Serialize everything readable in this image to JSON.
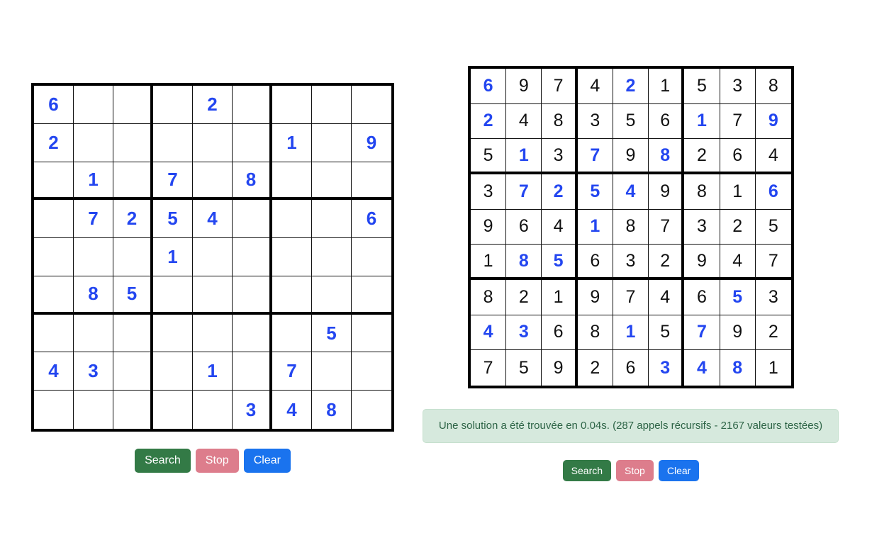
{
  "app": {
    "language": "fr",
    "accent_blue": "#2346f0",
    "button_colors": {
      "search": "#337a46",
      "stop": "#dd7d8c",
      "clear": "#1a73ee"
    },
    "status_colors": {
      "background": "#d6e9dd",
      "text": "#2d6446"
    }
  },
  "controls": {
    "search_label": "Search",
    "stop_label": "Stop",
    "clear_label": "Clear"
  },
  "puzzle_panel": {
    "title": "",
    "grid": {
      "size": 9,
      "rows": [
        [
          "6",
          "",
          "",
          "",
          "2",
          "",
          "",
          "",
          ""
        ],
        [
          "2",
          "",
          "",
          "",
          "",
          "",
          "1",
          "",
          "9"
        ],
        [
          "",
          "1",
          "",
          "7",
          "",
          "8",
          "",
          "",
          ""
        ],
        [
          "",
          "7",
          "2",
          "5",
          "4",
          "",
          "",
          "",
          "6"
        ],
        [
          "",
          "",
          "",
          "1",
          "",
          "",
          "",
          "",
          ""
        ],
        [
          "",
          "8",
          "5",
          "",
          "",
          "",
          "",
          "",
          ""
        ],
        [
          "",
          "",
          "",
          "",
          "",
          "",
          "",
          "5",
          ""
        ],
        [
          "4",
          "3",
          "",
          "",
          "1",
          "",
          "7",
          "",
          ""
        ],
        [
          "",
          "",
          "",
          "",
          "",
          "3",
          "4",
          "8",
          ""
        ]
      ],
      "given_flags": [
        [
          1,
          0,
          0,
          0,
          1,
          0,
          0,
          0,
          0
        ],
        [
          1,
          0,
          0,
          0,
          0,
          0,
          1,
          0,
          1
        ],
        [
          0,
          1,
          0,
          1,
          0,
          1,
          0,
          0,
          0
        ],
        [
          0,
          1,
          1,
          1,
          1,
          0,
          0,
          0,
          1
        ],
        [
          0,
          0,
          0,
          1,
          0,
          0,
          0,
          0,
          0
        ],
        [
          0,
          1,
          1,
          0,
          0,
          0,
          0,
          0,
          0
        ],
        [
          0,
          0,
          0,
          0,
          0,
          0,
          0,
          1,
          0
        ],
        [
          1,
          1,
          0,
          0,
          1,
          0,
          1,
          0,
          0
        ],
        [
          0,
          0,
          0,
          0,
          0,
          1,
          1,
          1,
          0
        ]
      ]
    }
  },
  "solution_panel": {
    "grid": {
      "size": 9,
      "rows": [
        [
          "6",
          "9",
          "7",
          "4",
          "2",
          "1",
          "5",
          "3",
          "8"
        ],
        [
          "2",
          "4",
          "8",
          "3",
          "5",
          "6",
          "1",
          "7",
          "9"
        ],
        [
          "5",
          "1",
          "3",
          "7",
          "9",
          "8",
          "2",
          "6",
          "4"
        ],
        [
          "3",
          "7",
          "2",
          "5",
          "4",
          "9",
          "8",
          "1",
          "6"
        ],
        [
          "9",
          "6",
          "4",
          "1",
          "8",
          "7",
          "3",
          "2",
          "5"
        ],
        [
          "1",
          "8",
          "5",
          "6",
          "3",
          "2",
          "9",
          "4",
          "7"
        ],
        [
          "8",
          "2",
          "1",
          "9",
          "7",
          "4",
          "6",
          "5",
          "3"
        ],
        [
          "4",
          "3",
          "6",
          "8",
          "1",
          "5",
          "7",
          "9",
          "2"
        ],
        [
          "7",
          "5",
          "9",
          "2",
          "6",
          "3",
          "4",
          "8",
          "1"
        ]
      ],
      "given_flags": [
        [
          1,
          0,
          0,
          0,
          1,
          0,
          0,
          0,
          0
        ],
        [
          1,
          0,
          0,
          0,
          0,
          0,
          1,
          0,
          1
        ],
        [
          0,
          1,
          0,
          1,
          0,
          1,
          0,
          0,
          0
        ],
        [
          0,
          1,
          1,
          1,
          1,
          0,
          0,
          0,
          1
        ],
        [
          0,
          0,
          0,
          1,
          0,
          0,
          0,
          0,
          0
        ],
        [
          0,
          1,
          1,
          0,
          0,
          0,
          0,
          0,
          0
        ],
        [
          0,
          0,
          0,
          0,
          0,
          0,
          0,
          1,
          0
        ],
        [
          1,
          1,
          0,
          0,
          1,
          0,
          1,
          0,
          0
        ],
        [
          0,
          0,
          0,
          0,
          0,
          1,
          1,
          1,
          0
        ]
      ]
    },
    "status_message": "Une solution a été trouvée en 0.04s. (287 appels récursifs - 2167 valeurs testées)"
  }
}
